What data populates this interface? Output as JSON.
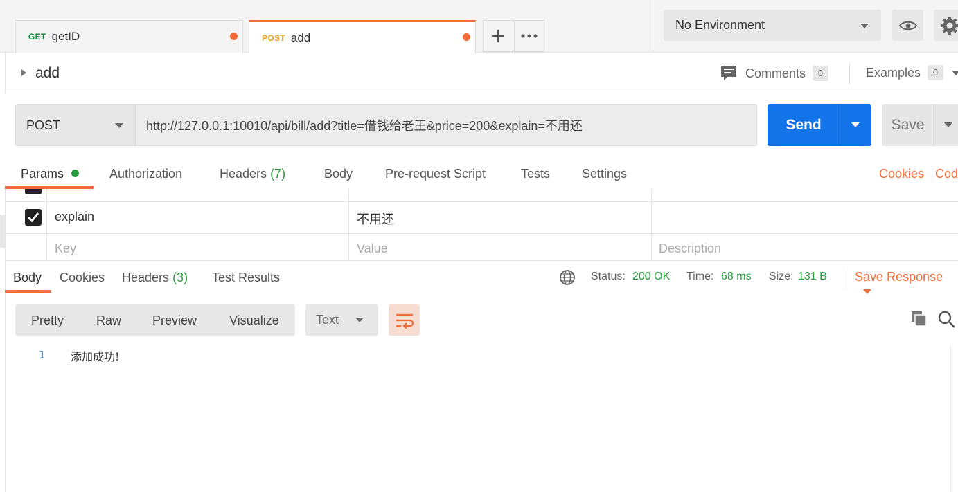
{
  "tabs": [
    {
      "method": "GET",
      "name": "getID"
    },
    {
      "method": "POST",
      "name": "add"
    }
  ],
  "environment": {
    "selected": "No Environment"
  },
  "request": {
    "name": "add",
    "comments_label": "Comments",
    "comments_count": "0",
    "examples_label": "Examples",
    "examples_count": "0",
    "method": "POST",
    "url": "http://127.0.0.1:10010/api/bill/add?title=借钱给老王&price=200&explain=不用还",
    "send_label": "Send",
    "save_label": "Save"
  },
  "request_tabs": {
    "params": "Params",
    "authorization": "Authorization",
    "headers": "Headers",
    "headers_count": "(7)",
    "body": "Body",
    "prerequest": "Pre-request Script",
    "tests": "Tests",
    "settings": "Settings",
    "cookies": "Cookies",
    "code": "Cod"
  },
  "params": {
    "rows": [
      {
        "checked": true,
        "key": "explain",
        "value": "不用还",
        "description": ""
      }
    ],
    "placeholders": {
      "key": "Key",
      "value": "Value",
      "description": "Description"
    }
  },
  "response": {
    "tabs": {
      "body": "Body",
      "cookies": "Cookies",
      "headers": "Headers",
      "headers_count": "(3)",
      "test_results": "Test Results"
    },
    "status_label": "Status:",
    "status_value": "200 OK",
    "time_label": "Time:",
    "time_value": "68 ms",
    "size_label": "Size:",
    "size_value": "131 B",
    "save_response": "Save Response",
    "views": [
      "Pretty",
      "Raw",
      "Preview",
      "Visualize"
    ],
    "format": "Text",
    "lines": [
      {
        "num": "1",
        "text": "添加成功!"
      }
    ]
  },
  "colors": {
    "accent": "#f26b3a",
    "send": "#1373e8",
    "success": "#2a9a3f"
  }
}
